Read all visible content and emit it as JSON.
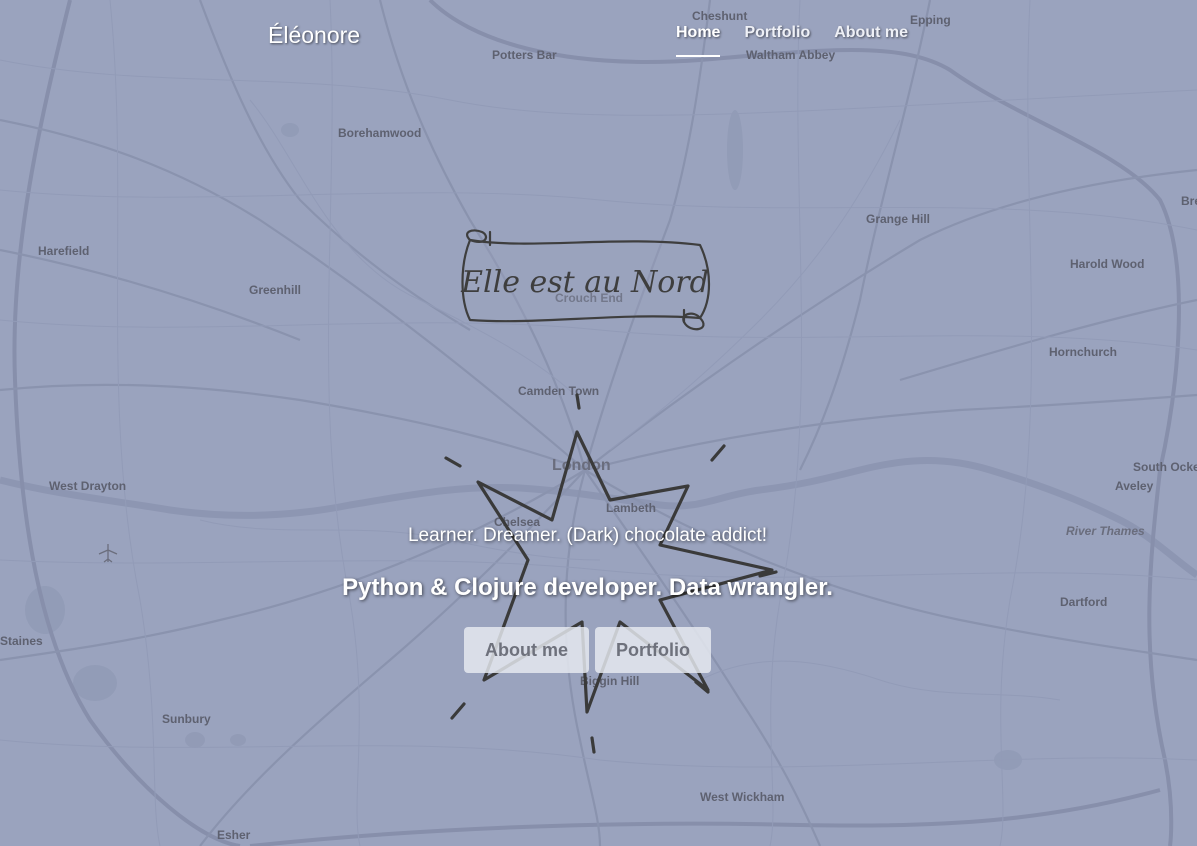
{
  "navbar": {
    "brand": "Éléonore",
    "links": [
      {
        "label": "Home",
        "active": true
      },
      {
        "label": "Portfolio",
        "active": false
      },
      {
        "label": "About me",
        "active": false
      }
    ]
  },
  "hero": {
    "logo_text": "Elle est au Nord",
    "tagline": "Learner. Dreamer. (Dark) chocolate addict!",
    "subtagline": "Python & Clojure developer. Data wrangler.",
    "buttons": {
      "about": "About me",
      "portfolio": "Portfolio"
    }
  },
  "map": {
    "labels": {
      "cheshunt": "Cheshunt",
      "epping": "Epping",
      "potters_bar": "Potters Bar",
      "waltham_abbey": "Waltham Abbey",
      "borehamwood": "Borehamwood",
      "grange_hill": "Grange Hill",
      "harefield": "Harefield",
      "greenhill": "Greenhill",
      "crouch_end": "Crouch End",
      "harold_wood": "Harold Wood",
      "hornchurch": "Hornchurch",
      "camden_town": "Camden Town",
      "london": "London",
      "west_drayton": "West Drayton",
      "chelsea": "Chelsea",
      "lambeth": "Lambeth",
      "south_ockendon": "South Ocke",
      "aveley": "Aveley",
      "river_thames": "River Thames",
      "staines": "Staines",
      "dartford": "Dartford",
      "biggin_hill": "Biggin Hill",
      "sunbury": "Sunbury",
      "west_wickham": "West Wickham",
      "esher": "Esher",
      "brentwood": "Bre"
    }
  },
  "colors": {
    "background": "#9aa3be",
    "ink": "#3c3c3c",
    "text_light": "#ffffff"
  },
  "icons": [
    "airport-icon",
    "compass-star-icon",
    "scroll-banner-icon"
  ]
}
